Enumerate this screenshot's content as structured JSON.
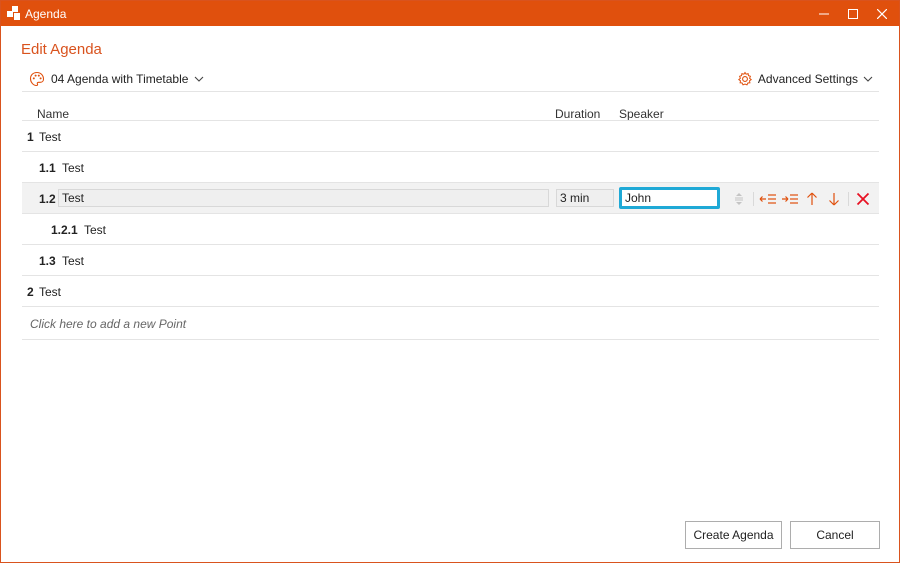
{
  "window": {
    "title": "Agenda"
  },
  "heading": "Edit Agenda",
  "template": {
    "label": "04 Agenda with Timetable"
  },
  "advanced": {
    "label": "Advanced Settings"
  },
  "columns": {
    "name": "Name",
    "duration": "Duration",
    "speaker": "Speaker"
  },
  "rows": [
    {
      "num": "1",
      "name": "Test"
    },
    {
      "num": "1.1",
      "name": "Test"
    },
    {
      "num": "1.2",
      "name": "Test",
      "duration": "3 min",
      "speaker": "John"
    },
    {
      "num": "1.2.1",
      "name": "Test"
    },
    {
      "num": "1.3",
      "name": "Test"
    },
    {
      "num": "2",
      "name": "Test"
    }
  ],
  "add_point": "Click here to add a new Point",
  "buttons": {
    "create": "Create Agenda",
    "cancel": "Cancel"
  },
  "colors": {
    "accent": "#e0500d",
    "focus": "#1fa9d6",
    "delete": "#e81123"
  }
}
